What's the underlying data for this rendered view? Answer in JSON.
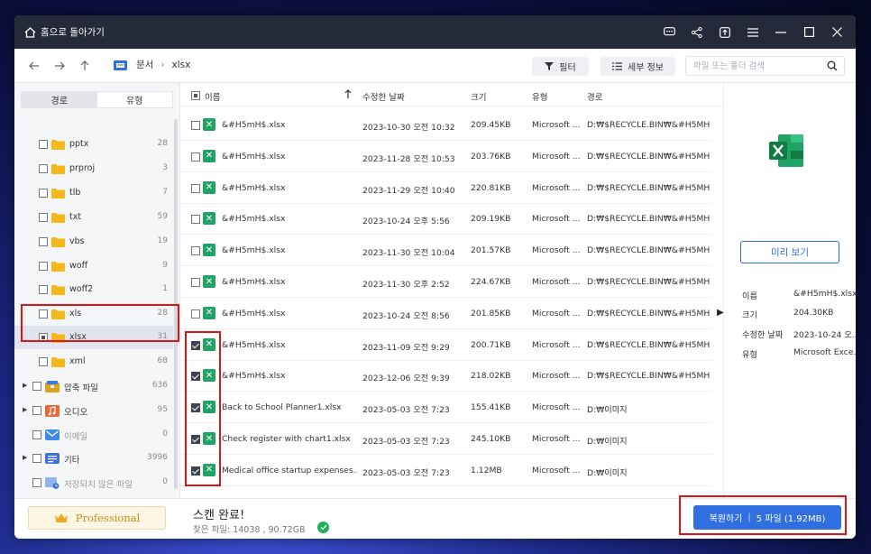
{
  "titlebar": {
    "home_label": "홈으로 돌아가기"
  },
  "toolbar": {
    "breadcrumb": [
      "문서",
      "xlsx"
    ],
    "filter_label": "필터",
    "details_label": "세부 정보",
    "search_placeholder": "파일 또는 폴더 검색"
  },
  "sidebar": {
    "tabs": [
      "경로",
      "유형"
    ],
    "items": [
      {
        "name": "pptx",
        "count": "28"
      },
      {
        "name": "prproj",
        "count": "3"
      },
      {
        "name": "tlb",
        "count": "7"
      },
      {
        "name": "txt",
        "count": "59"
      },
      {
        "name": "vbs",
        "count": "19"
      },
      {
        "name": "woff",
        "count": "9"
      },
      {
        "name": "woff2",
        "count": "1"
      },
      {
        "name": "xls",
        "count": "28"
      },
      {
        "name": "xlsx",
        "count": "31"
      },
      {
        "name": "xml",
        "count": "68"
      },
      {
        "name": "압축 파일",
        "count": "636"
      },
      {
        "name": "오디오",
        "count": "95"
      },
      {
        "name": "이메일",
        "count": "0"
      },
      {
        "name": "기타",
        "count": "3996"
      },
      {
        "name": "저장되지 않은 파일",
        "count": "0"
      }
    ]
  },
  "list": {
    "headers": {
      "name": "이름",
      "date": "수정한 날짜",
      "size": "크기",
      "type": "유형",
      "path": "경로"
    },
    "rows": [
      {
        "name": "&#H5mH$.xlsx",
        "date": "2023-10-30 오전 10:32",
        "size": "209.45KB",
        "type": "Microsoft ...",
        "path": "D:₩$RECYCLE.BIN₩&#H5MH$",
        "checked": false
      },
      {
        "name": "&#H5mH$.xlsx",
        "date": "2023-11-28 오전 10:53",
        "size": "203.76KB",
        "type": "Microsoft ...",
        "path": "D:₩$RECYCLE.BIN₩&#H5MH$",
        "checked": false
      },
      {
        "name": "&#H5mH$.xlsx",
        "date": "2023-11-29 오전 10:40",
        "size": "220.81KB",
        "type": "Microsoft ...",
        "path": "D:₩$RECYCLE.BIN₩&#H5MH$",
        "checked": false
      },
      {
        "name": "&#H5mH$.xlsx",
        "date": "2023-10-24 오후 5:56",
        "size": "209.19KB",
        "type": "Microsoft ...",
        "path": "D:₩$RECYCLE.BIN₩&#H5MH$",
        "checked": false
      },
      {
        "name": "&#H5mH$.xlsx",
        "date": "2023-11-30 오전 10:04",
        "size": "201.57KB",
        "type": "Microsoft ...",
        "path": "D:₩$RECYCLE.BIN₩&#H5MH$",
        "checked": false
      },
      {
        "name": "&#H5mH$.xlsx",
        "date": "2023-11-30 오후 2:52",
        "size": "224.67KB",
        "type": "Microsoft ...",
        "path": "D:₩$RECYCLE.BIN₩&#H5MH$",
        "checked": false
      },
      {
        "name": "&#H5mH$.xlsx",
        "date": "2023-10-24 오전 8:56",
        "size": "201.85KB",
        "type": "Microsoft ...",
        "path": "D:₩$RECYCLE.BIN₩&#H5MH$",
        "checked": false
      },
      {
        "name": "&#H5mH$.xlsx",
        "date": "2023-11-09 오전 9:29",
        "size": "200.71KB",
        "type": "Microsoft ...",
        "path": "D:₩$RECYCLE.BIN₩&#H5MH$",
        "checked": true
      },
      {
        "name": "&#H5mH$.xlsx",
        "date": "2023-12-06 오전 9:39",
        "size": "218.02KB",
        "type": "Microsoft ...",
        "path": "D:₩$RECYCLE.BIN₩&#H5MH$",
        "checked": true
      },
      {
        "name": "Back to School Planner1.xlsx",
        "date": "2023-05-03 오전 7:23",
        "size": "155.41KB",
        "type": "Microsoft ...",
        "path": "D:₩이미지",
        "checked": true
      },
      {
        "name": "Check register with chart1.xlsx",
        "date": "2023-05-03 오전 7:23",
        "size": "245.10KB",
        "type": "Microsoft ...",
        "path": "D:₩이미지",
        "checked": true
      },
      {
        "name": "Medical office startup expenses...",
        "date": "2023-05-03 오전 7:23",
        "size": "1.12MB",
        "type": "Microsoft ...",
        "path": "D:₩이미지",
        "checked": true
      }
    ]
  },
  "panel": {
    "preview_label": "미리 보기",
    "props": [
      {
        "label": "이름",
        "value": "&#H5mH$.xlsx"
      },
      {
        "label": "크기",
        "value": "204.30KB"
      },
      {
        "label": "수정한 날짜",
        "value": "2023-10-24 오..."
      },
      {
        "label": "유형",
        "value": "Microsoft Exce..."
      }
    ]
  },
  "bottom": {
    "pro_label": "Professional",
    "scan_title": "스캔 완료!",
    "scan_sub": "찾은 파일: 14038 , 90.72GB",
    "recover_label": "복원하기",
    "recover_files": "5 파일 (1.92MB)"
  },
  "colors": {
    "accent": "#2f6fe0",
    "excel": "#21a366",
    "titlebar": "#252a3a",
    "highlight": "#e01414",
    "folder": "#f5b81c"
  }
}
